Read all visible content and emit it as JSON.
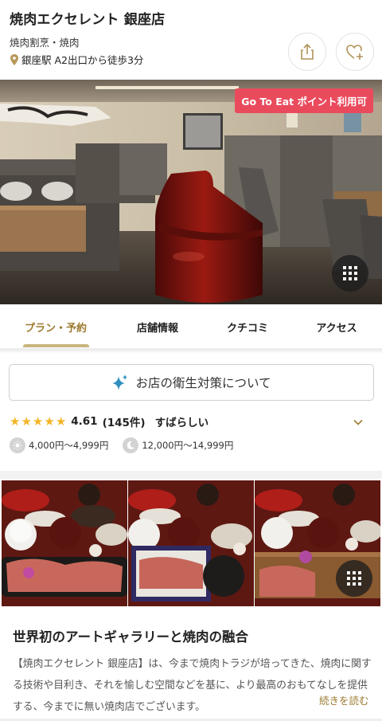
{
  "header": {
    "title": "焼肉エクセレント 銀座店",
    "genre": "焼肉割烹・焼肉",
    "access": "銀座駅 A2出口から徒歩3分",
    "share_icon": "share-icon",
    "favorite_icon": "heart-plus-icon"
  },
  "photo": {
    "badge": "Go To Eat ポイント利用可",
    "gallery_icon": "grid-icon"
  },
  "tabs": [
    {
      "label": "プラン・予約",
      "active": true
    },
    {
      "label": "店舗情報",
      "active": false
    },
    {
      "label": "クチコミ",
      "active": false
    },
    {
      "label": "アクセス",
      "active": false
    }
  ],
  "hygiene": {
    "label": "お店の衛生対策について",
    "icon": "sparkle-icon"
  },
  "rating": {
    "stars": 5,
    "score": "4.61",
    "count": "(145件)",
    "label": "すばらしい"
  },
  "prices": {
    "lunch": "4,000円～4,999円",
    "dinner": "12,000円～14,999円"
  },
  "description": {
    "title": "世界初のアートギャラリーと焼肉の融合",
    "body": "【焼肉エクセレント 銀座店】は、今まで焼肉トラジが培ってきた、焼肉に関する技術や目利き、それを愉しむ空間などを基に、より最高のおもてなしを提供する、今までに無い焼肉店でございます。",
    "read_more": "続きを読む"
  },
  "colors": {
    "accent": "#9c7a30",
    "badge": "#e94b5d",
    "star": "#f4b526",
    "tab_underline": "#c9b67e"
  }
}
